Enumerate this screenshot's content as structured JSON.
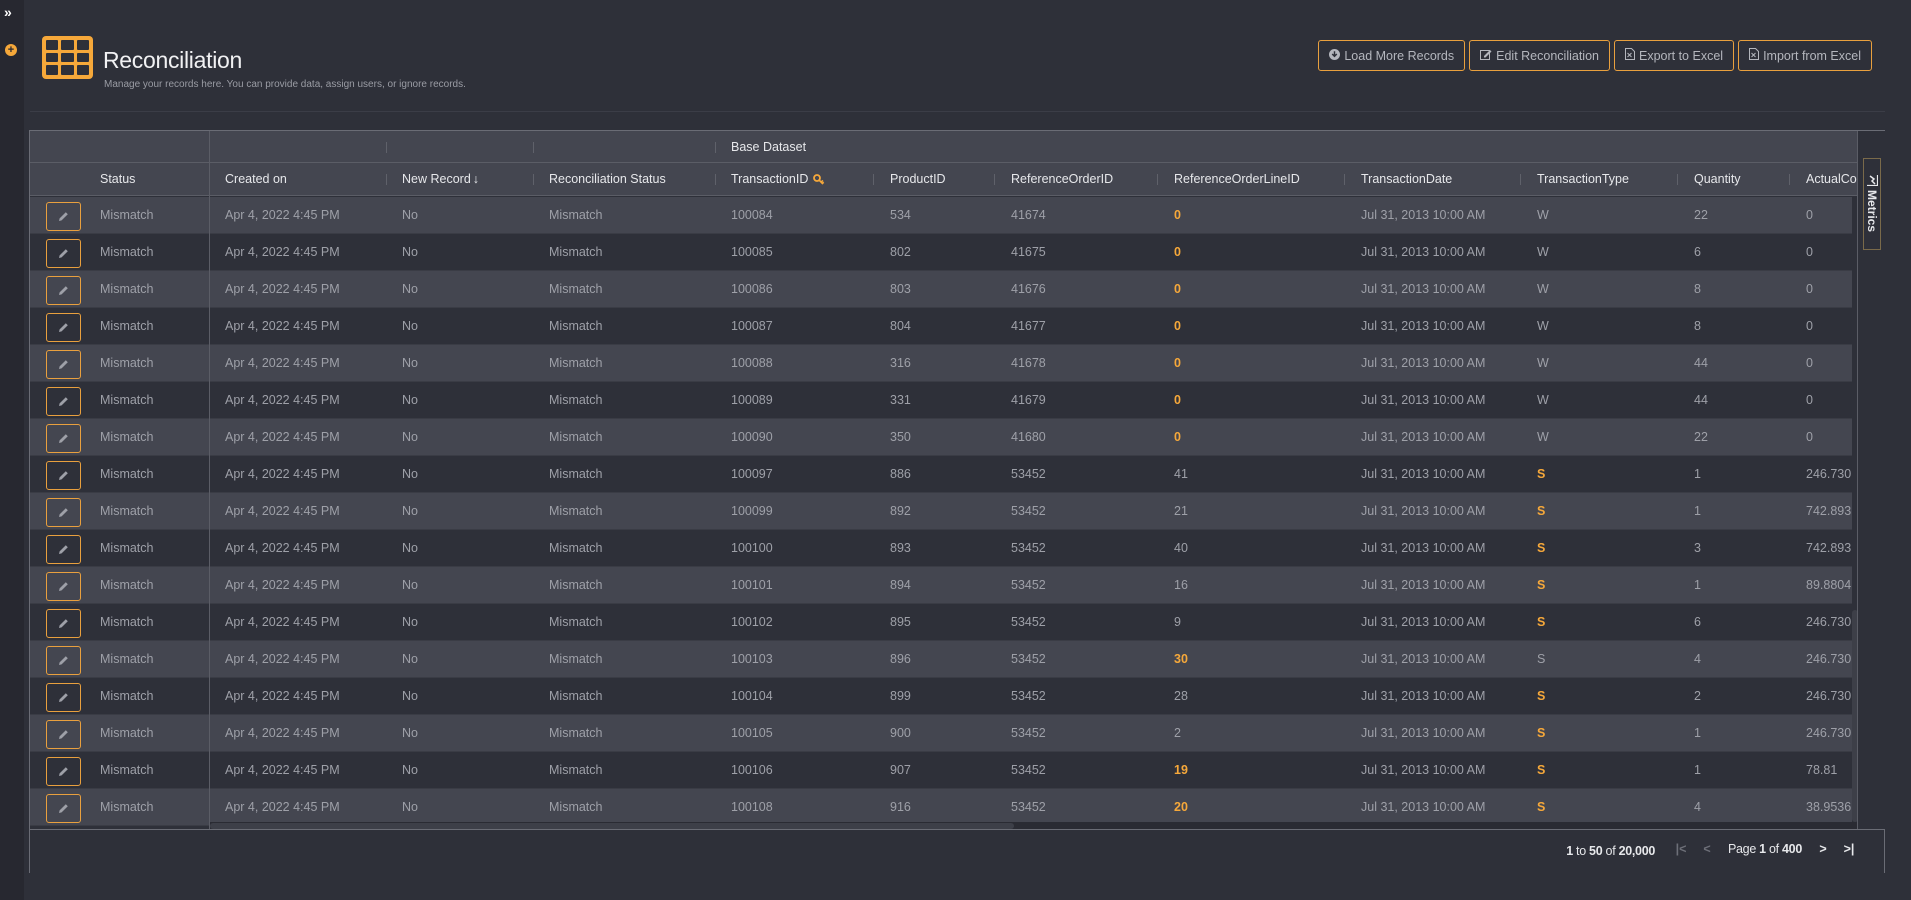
{
  "sidebar": {
    "expand_icon": "»",
    "add_icon": "+"
  },
  "header": {
    "title": "Reconciliation",
    "subtitle": "Manage your records here. You can provide data, assign users, or ignore records.",
    "logo_icon": "table-grid-icon"
  },
  "toolbar": {
    "buttons": [
      {
        "label": "Load More Records",
        "icon": "⬇"
      },
      {
        "label": "Edit Reconciliation",
        "icon": "✎"
      },
      {
        "label": "Export to Excel",
        "icon": "🗎"
      },
      {
        "label": "Import from Excel",
        "icon": "🗎"
      }
    ]
  },
  "grid": {
    "group_header": "Base Dataset",
    "columns": [
      {
        "label": ""
      },
      {
        "label": "Status"
      },
      {
        "label": "Created on"
      },
      {
        "label": "New Record",
        "sort": "↓"
      },
      {
        "label": "Reconciliation Status"
      },
      {
        "label": "TransactionID",
        "key_icon": "🔑"
      },
      {
        "label": "ProductID"
      },
      {
        "label": "ReferenceOrderID"
      },
      {
        "label": "ReferenceOrderLineID"
      },
      {
        "label": "TransactionDate"
      },
      {
        "label": "TransactionType"
      },
      {
        "label": "Quantity"
      },
      {
        "label": "ActualCos"
      }
    ],
    "rows": [
      {
        "status": "Mismatch",
        "created": "Apr 4, 2022 4:45 PM",
        "new": "No",
        "recon": "Mismatch",
        "tid": "100084",
        "pid": "534",
        "roid": "41674",
        "rolid": "0",
        "rolid_hl": true,
        "date": "Jul 31, 2013 10:00 AM",
        "type": "W",
        "type_hl": false,
        "qty": "22",
        "cost": "0"
      },
      {
        "status": "Mismatch",
        "created": "Apr 4, 2022 4:45 PM",
        "new": "No",
        "recon": "Mismatch",
        "tid": "100085",
        "pid": "802",
        "roid": "41675",
        "rolid": "0",
        "rolid_hl": true,
        "date": "Jul 31, 2013 10:00 AM",
        "type": "W",
        "type_hl": false,
        "qty": "6",
        "cost": "0"
      },
      {
        "status": "Mismatch",
        "created": "Apr 4, 2022 4:45 PM",
        "new": "No",
        "recon": "Mismatch",
        "tid": "100086",
        "pid": "803",
        "roid": "41676",
        "rolid": "0",
        "rolid_hl": true,
        "date": "Jul 31, 2013 10:00 AM",
        "type": "W",
        "type_hl": false,
        "qty": "8",
        "cost": "0"
      },
      {
        "status": "Mismatch",
        "created": "Apr 4, 2022 4:45 PM",
        "new": "No",
        "recon": "Mismatch",
        "tid": "100087",
        "pid": "804",
        "roid": "41677",
        "rolid": "0",
        "rolid_hl": true,
        "date": "Jul 31, 2013 10:00 AM",
        "type": "W",
        "type_hl": false,
        "qty": "8",
        "cost": "0"
      },
      {
        "status": "Mismatch",
        "created": "Apr 4, 2022 4:45 PM",
        "new": "No",
        "recon": "Mismatch",
        "tid": "100088",
        "pid": "316",
        "roid": "41678",
        "rolid": "0",
        "rolid_hl": true,
        "date": "Jul 31, 2013 10:00 AM",
        "type": "W",
        "type_hl": false,
        "qty": "44",
        "cost": "0"
      },
      {
        "status": "Mismatch",
        "created": "Apr 4, 2022 4:45 PM",
        "new": "No",
        "recon": "Mismatch",
        "tid": "100089",
        "pid": "331",
        "roid": "41679",
        "rolid": "0",
        "rolid_hl": true,
        "date": "Jul 31, 2013 10:00 AM",
        "type": "W",
        "type_hl": false,
        "qty": "44",
        "cost": "0"
      },
      {
        "status": "Mismatch",
        "created": "Apr 4, 2022 4:45 PM",
        "new": "No",
        "recon": "Mismatch",
        "tid": "100090",
        "pid": "350",
        "roid": "41680",
        "rolid": "0",
        "rolid_hl": true,
        "date": "Jul 31, 2013 10:00 AM",
        "type": "W",
        "type_hl": false,
        "qty": "22",
        "cost": "0"
      },
      {
        "status": "Mismatch",
        "created": "Apr 4, 2022 4:45 PM",
        "new": "No",
        "recon": "Mismatch",
        "tid": "100097",
        "pid": "886",
        "roid": "53452",
        "rolid": "41",
        "rolid_hl": false,
        "date": "Jul 31, 2013 10:00 AM",
        "type": "S",
        "type_hl": true,
        "qty": "1",
        "cost": "246.730"
      },
      {
        "status": "Mismatch",
        "created": "Apr 4, 2022 4:45 PM",
        "new": "No",
        "recon": "Mismatch",
        "tid": "100099",
        "pid": "892",
        "roid": "53452",
        "rolid": "21",
        "rolid_hl": false,
        "date": "Jul 31, 2013 10:00 AM",
        "type": "S",
        "type_hl": true,
        "qty": "1",
        "cost": "742.893"
      },
      {
        "status": "Mismatch",
        "created": "Apr 4, 2022 4:45 PM",
        "new": "No",
        "recon": "Mismatch",
        "tid": "100100",
        "pid": "893",
        "roid": "53452",
        "rolid": "40",
        "rolid_hl": false,
        "date": "Jul 31, 2013 10:00 AM",
        "type": "S",
        "type_hl": true,
        "qty": "3",
        "cost": "742.893"
      },
      {
        "status": "Mismatch",
        "created": "Apr 4, 2022 4:45 PM",
        "new": "No",
        "recon": "Mismatch",
        "tid": "100101",
        "pid": "894",
        "roid": "53452",
        "rolid": "16",
        "rolid_hl": false,
        "date": "Jul 31, 2013 10:00 AM",
        "type": "S",
        "type_hl": true,
        "qty": "1",
        "cost": "89.8804"
      },
      {
        "status": "Mismatch",
        "created": "Apr 4, 2022 4:45 PM",
        "new": "No",
        "recon": "Mismatch",
        "tid": "100102",
        "pid": "895",
        "roid": "53452",
        "rolid": "9",
        "rolid_hl": false,
        "date": "Jul 31, 2013 10:00 AM",
        "type": "S",
        "type_hl": true,
        "qty": "6",
        "cost": "246.730"
      },
      {
        "status": "Mismatch",
        "created": "Apr 4, 2022 4:45 PM",
        "new": "No",
        "recon": "Mismatch",
        "tid": "100103",
        "pid": "896",
        "roid": "53452",
        "rolid": "30",
        "rolid_hl": true,
        "date": "Jul 31, 2013 10:00 AM",
        "type": "S",
        "type_hl": false,
        "qty": "4",
        "cost": "246.730"
      },
      {
        "status": "Mismatch",
        "created": "Apr 4, 2022 4:45 PM",
        "new": "No",
        "recon": "Mismatch",
        "tid": "100104",
        "pid": "899",
        "roid": "53452",
        "rolid": "28",
        "rolid_hl": false,
        "date": "Jul 31, 2013 10:00 AM",
        "type": "S",
        "type_hl": true,
        "qty": "2",
        "cost": "246.730"
      },
      {
        "status": "Mismatch",
        "created": "Apr 4, 2022 4:45 PM",
        "new": "No",
        "recon": "Mismatch",
        "tid": "100105",
        "pid": "900",
        "roid": "53452",
        "rolid": "2",
        "rolid_hl": false,
        "date": "Jul 31, 2013 10:00 AM",
        "type": "S",
        "type_hl": true,
        "qty": "1",
        "cost": "246.730"
      },
      {
        "status": "Mismatch",
        "created": "Apr 4, 2022 4:45 PM",
        "new": "No",
        "recon": "Mismatch",
        "tid": "100106",
        "pid": "907",
        "roid": "53452",
        "rolid": "19",
        "rolid_hl": true,
        "date": "Jul 31, 2013 10:00 AM",
        "type": "S",
        "type_hl": true,
        "qty": "1",
        "cost": "78.81"
      },
      {
        "status": "Mismatch",
        "created": "Apr 4, 2022 4:45 PM",
        "new": "No",
        "recon": "Mismatch",
        "tid": "100108",
        "pid": "916",
        "roid": "53452",
        "rolid": "20",
        "rolid_hl": true,
        "date": "Jul 31, 2013 10:00 AM",
        "type": "S",
        "type_hl": true,
        "qty": "4",
        "cost": "38.9536"
      }
    ]
  },
  "side_panel": {
    "metrics_label": "Metrics"
  },
  "pagination": {
    "range_start": "1",
    "range_to": "to",
    "range_end": "50",
    "range_of": "of",
    "total": "20,000",
    "page_label": "Page",
    "page": "1",
    "page_of": "of",
    "page_total": "400",
    "first_icon": "|<",
    "prev_icon": "<",
    "next_icon": ">",
    "last_icon": ">|"
  },
  "colors": {
    "accent": "#f6a83a",
    "background": "#2e3039",
    "row_alt": "#444650"
  }
}
